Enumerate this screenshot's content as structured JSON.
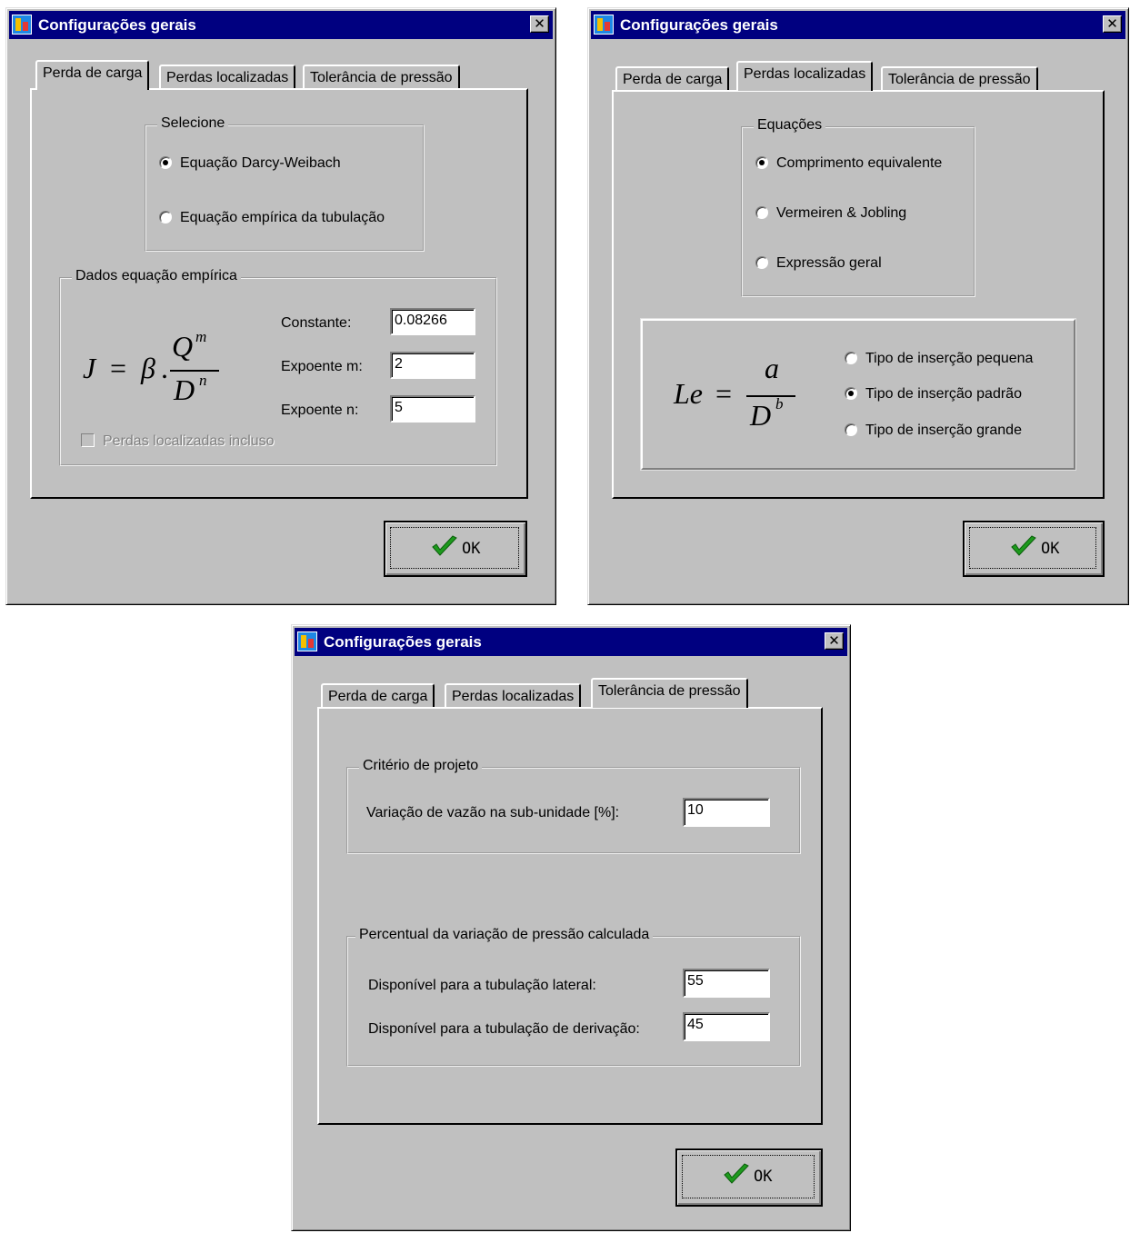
{
  "dialog_title": "Configurações gerais",
  "close_glyph": "✕",
  "tabs": [
    "Perda de carga",
    "Perdas localizadas",
    "Tolerância de pressão"
  ],
  "ok_label": "OK",
  "icons": {
    "app": "app-icon",
    "close": "close-icon",
    "ok": "check-icon"
  },
  "colors": {
    "titlebar": "#000080",
    "face": "#c0c0c0",
    "check": "#1d9a1d"
  },
  "perda_de_carga": {
    "select_legend": "Selecione",
    "options": [
      "Equação Darcy-Weibach",
      "Equação empírica da tubulação"
    ],
    "selected_option": 0,
    "empirical_legend": "Dados equação empírica",
    "formula": {
      "lhs": "J",
      "beta": "β",
      "numerator": "Q",
      "num_exp": "m",
      "denominator": "D",
      "den_exp": "n"
    },
    "fields": [
      {
        "label": "Constante:",
        "value": "0.08266"
      },
      {
        "label": "Expoente m:",
        "value": "2"
      },
      {
        "label": "Expoente n:",
        "value": "5"
      }
    ],
    "checkbox_label": "Perdas localizadas incluso"
  },
  "perdas_localizadas": {
    "equations_legend": "Equações",
    "equations": [
      "Comprimento equivalente",
      "Vermeiren & Jobling",
      "Expressão geral"
    ],
    "selected_equation": 0,
    "formula": {
      "lhs": "Le",
      "numerator": "a",
      "denominator": "D",
      "den_exp": "b"
    },
    "insertion_types": [
      "Tipo de inserção pequena",
      "Tipo de inserção padrão",
      "Tipo de inserção grande"
    ],
    "selected_insertion": 1
  },
  "tolerancia": {
    "criteria_legend": "Critério de projeto",
    "flow_label": "Variação de vazão na sub-unidade [%]:",
    "flow_value": "10",
    "pressure_legend": "Percentual da variação de pressão calculada",
    "lateral_label": "Disponível para a tubulação lateral:",
    "lateral_value": "55",
    "derivation_label": "Disponível para a tubulação de derivação:",
    "derivation_value": "45"
  }
}
